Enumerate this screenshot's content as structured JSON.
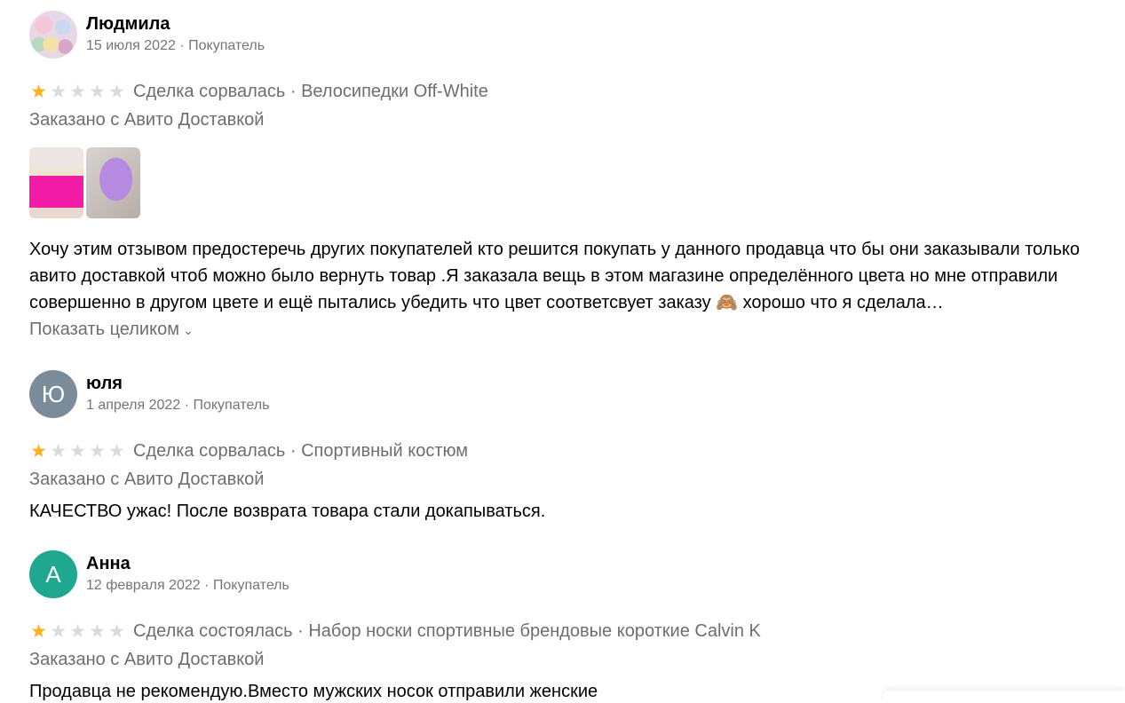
{
  "reviews": [
    {
      "author": "Людмила",
      "avatar_letter": "",
      "date": "15 июля 2022",
      "separator": "·",
      "role": "Покупатель",
      "rating": 1,
      "max_rating": 5,
      "deal_text": "Сделка сорвалась · Велосипедки Off-White",
      "delivery": "Заказано с Авито Доставкой",
      "photos": [
        "photo-shorts-pink",
        "photo-package-lilac"
      ],
      "text": "Хочу этим отзывом предостеречь других покупателей кто решится покупать у данного продавца что бы они заказывали только авито доставкой чтоб можно было вернуть товар .Я заказала вещь в этом магазине определённого цвета но мне отправили совершенно в другом цвете и ещё пытались убедить что цвет соответсвует заказу 🙈 хорошо что я сделала…",
      "expand_label": "Показать целиком"
    },
    {
      "author": "юля",
      "avatar_letter": "Ю",
      "date": "1 апреля 2022",
      "separator": "·",
      "role": "Покупатель",
      "rating": 1,
      "max_rating": 5,
      "deal_text": "Сделка сорвалась · Спортивный костюм",
      "delivery": "Заказано с Авито Доставкой",
      "text": "КАЧЕСТВО ужас! После возврата товара стали докапываться."
    },
    {
      "author": "Анна",
      "avatar_letter": "А",
      "date": "12 февраля 2022",
      "separator": "·",
      "role": "Покупатель",
      "rating": 1,
      "max_rating": 5,
      "deal_text": "Сделка состоялась · Набор носки спортивные брендовые короткие Calvin K",
      "delivery": "Заказано с Авито Доставкой",
      "text": "Продавца не рекомендую.Вместо мужских носок отправили женские"
    }
  ],
  "colors": {
    "star_on": "#ffb021",
    "star_off": "#dadada",
    "avatar_gray": "#7a8b99",
    "avatar_teal": "#1fa88f",
    "muted_text": "#6e6e6e"
  },
  "icons": {
    "star": "star-icon",
    "expand": "chevron-down-icon"
  }
}
